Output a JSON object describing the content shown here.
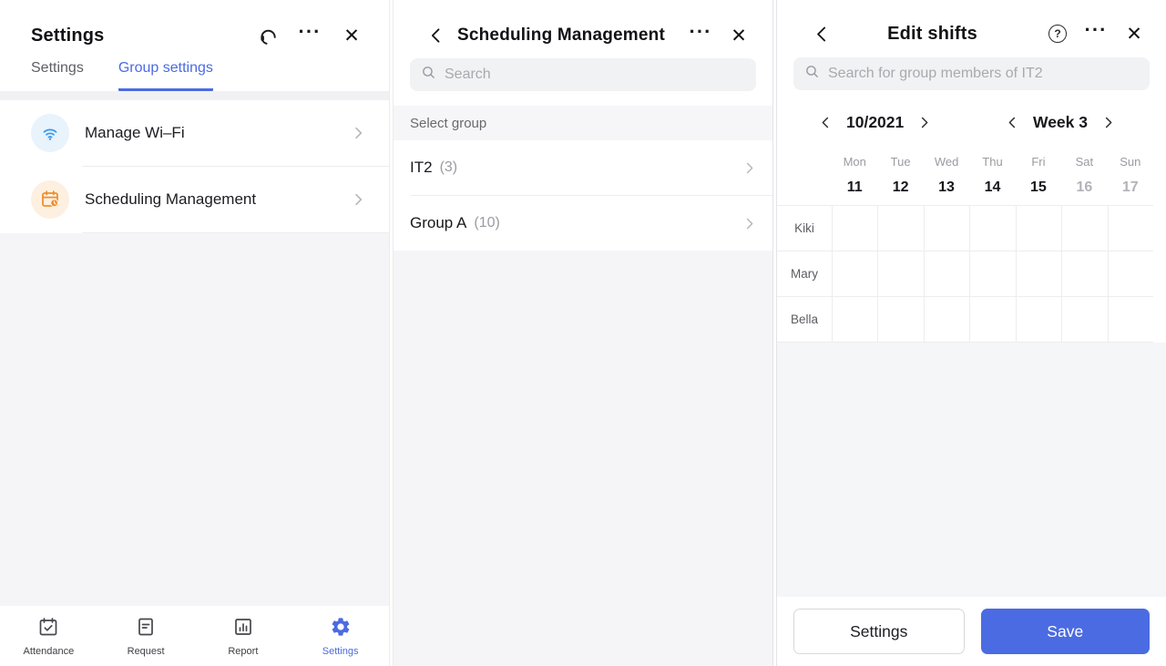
{
  "accent_color": "#4b6be2",
  "icons": {
    "more": "···",
    "close": "✕",
    "help": "?",
    "headset": "headset-support",
    "search": "magnifier",
    "back": "chevron-left"
  },
  "panels": {
    "settings": {
      "title": "Settings",
      "tabs": [
        {
          "label": "Settings",
          "active": false
        },
        {
          "label": "Group settings",
          "active": true
        }
      ],
      "items": [
        {
          "label": "Manage Wi–Fi",
          "icon": "wifi-icon"
        },
        {
          "label": "Scheduling Management",
          "icon": "calendar-clock-icon"
        }
      ],
      "nav": [
        {
          "label": "Attendance",
          "icon": "attendance-icon",
          "active": false
        },
        {
          "label": "Request",
          "icon": "request-icon",
          "active": false
        },
        {
          "label": "Report",
          "icon": "report-icon",
          "active": false
        },
        {
          "label": "Settings",
          "icon": "settings-gear-icon",
          "active": true
        }
      ]
    },
    "scheduling": {
      "title": "Scheduling Management",
      "search_placeholder": "Search",
      "section_header": "Select group",
      "groups": [
        {
          "name": "IT2",
          "count": "(3)"
        },
        {
          "name": "Group A",
          "count": "(10)"
        }
      ]
    },
    "edit_shifts": {
      "title": "Edit shifts",
      "search_placeholder": "Search for group members of IT2",
      "month": "10/2021",
      "week": "Week 3",
      "days": [
        {
          "weekday": "Mon",
          "date": "11",
          "muted": false
        },
        {
          "weekday": "Tue",
          "date": "12",
          "muted": false
        },
        {
          "weekday": "Wed",
          "date": "13",
          "muted": false
        },
        {
          "weekday": "Thu",
          "date": "14",
          "muted": false
        },
        {
          "weekday": "Fri",
          "date": "15",
          "muted": false
        },
        {
          "weekday": "Sat",
          "date": "16",
          "muted": true
        },
        {
          "weekday": "Sun",
          "date": "17",
          "muted": true
        }
      ],
      "members": [
        "Kiki",
        "Mary",
        "Bella"
      ],
      "buttons": {
        "settings": "Settings",
        "save": "Save"
      }
    }
  }
}
